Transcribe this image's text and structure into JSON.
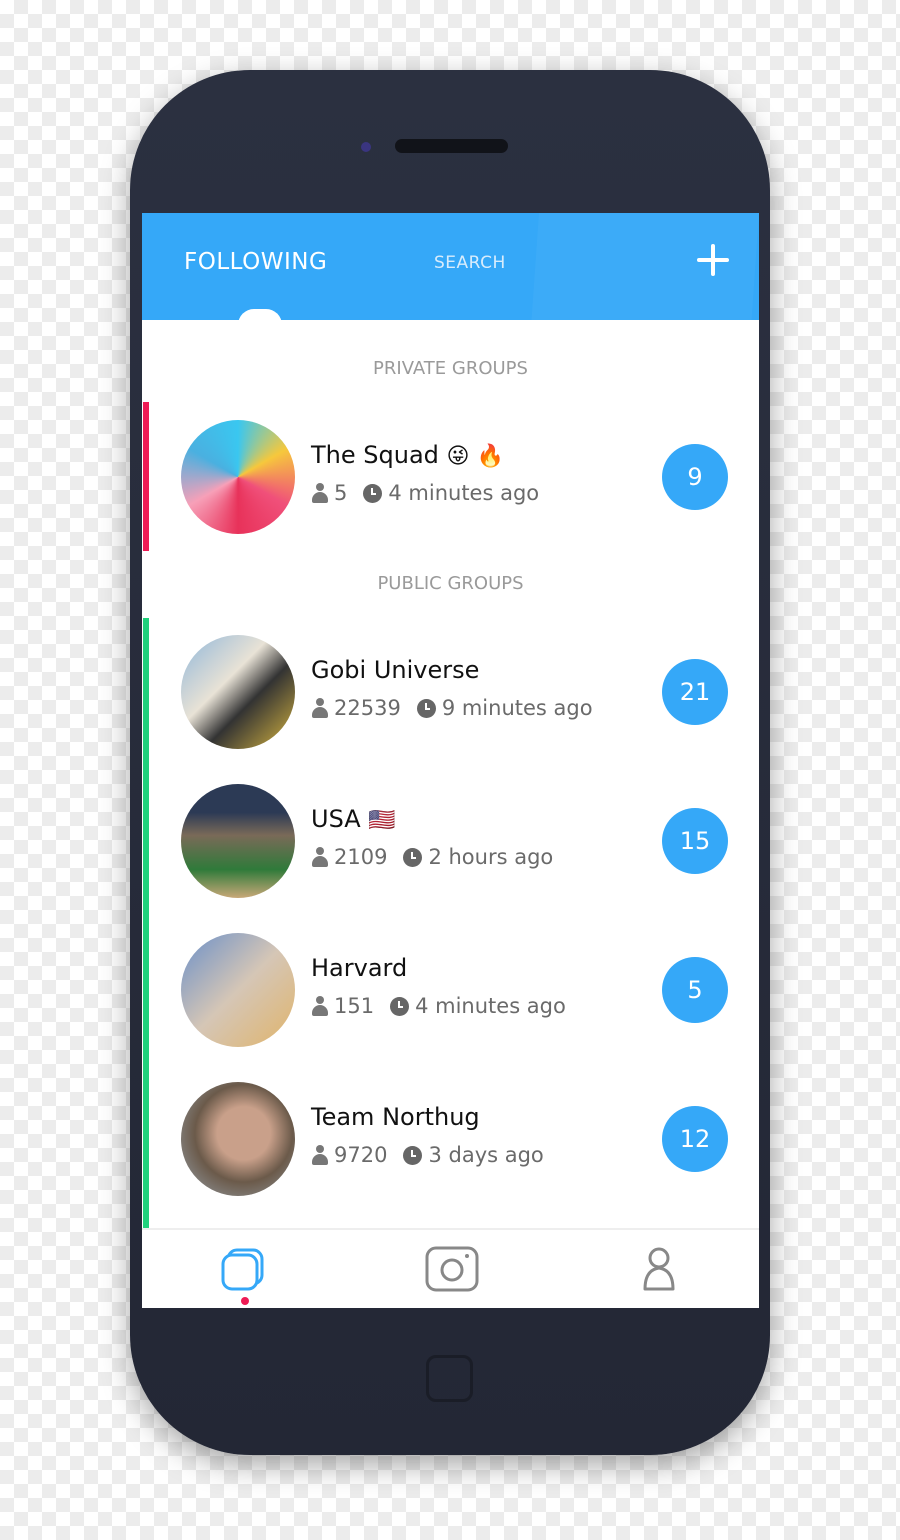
{
  "header": {
    "tabs": [
      {
        "label": "FOLLOWING",
        "active": true
      },
      {
        "label": "SEARCH",
        "active": false
      }
    ],
    "add_icon": "plus-icon",
    "accent": "#35a8f8"
  },
  "sections": {
    "private": "PRIVATE GROUPS",
    "public": "PUBLIC GROUPS"
  },
  "groups": [
    {
      "name": "The Squad",
      "emoji": "😜 🔥",
      "members": "5",
      "time": "4 minutes ago",
      "count": "9",
      "type": "private",
      "bar_color": "#ee1b55"
    },
    {
      "name": "Gobi Universe",
      "emoji": "",
      "members": "22539",
      "time": "9 minutes ago",
      "count": "21",
      "type": "public",
      "bar_color": "#20d17c"
    },
    {
      "name": "USA",
      "emoji": "🇺🇸",
      "members": "2109",
      "time": "2 hours ago",
      "count": "15",
      "type": "public",
      "bar_color": "#20d17c"
    },
    {
      "name": "Harvard",
      "emoji": "",
      "members": "151",
      "time": "4 minutes ago",
      "count": "5",
      "type": "public",
      "bar_color": "#20d17c"
    },
    {
      "name": "Team Northug",
      "emoji": "",
      "members": "9720",
      "time": "3 days ago",
      "count": "12",
      "type": "public",
      "bar_color": "#20d17c"
    }
  ],
  "nav": [
    {
      "icon": "groups-icon",
      "active": true
    },
    {
      "icon": "camera-icon",
      "active": false
    },
    {
      "icon": "profile-icon",
      "active": false
    }
  ]
}
